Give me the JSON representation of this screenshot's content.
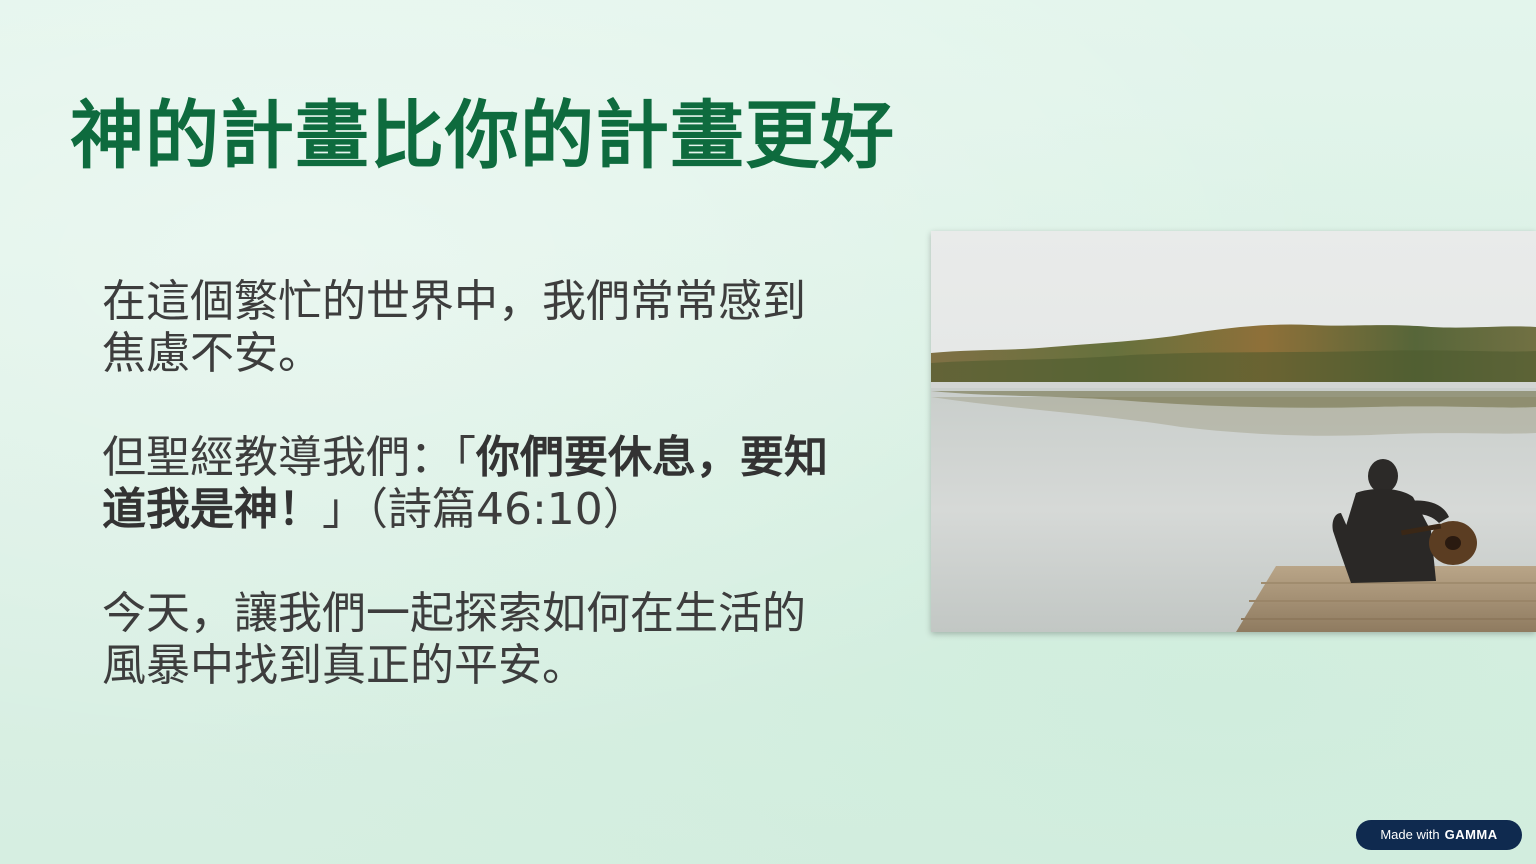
{
  "slide": {
    "title": "神的計畫比你的計畫更好",
    "paragraphs": {
      "p1": "在這個繁忙的世界中，我們常常感到焦慮不安。",
      "p2_prefix": "但聖經教導我們：「",
      "p2_bold": "你們要休息，要知道我是神！",
      "p2_suffix": "」（詩篇46:10）",
      "p3": "今天，讓我們一起探索如何在生活的風暴中找到真正的平安。"
    }
  },
  "image": {
    "subject": "man-with-guitar-on-lake-dock"
  },
  "badge": {
    "prefix": "Made with",
    "brand": "GAMMA"
  },
  "colors": {
    "title": "#0e6b3e",
    "body_text": "#3d3d3d",
    "background": "#dcf1e6",
    "badge_bg": "#0f2a4f"
  }
}
